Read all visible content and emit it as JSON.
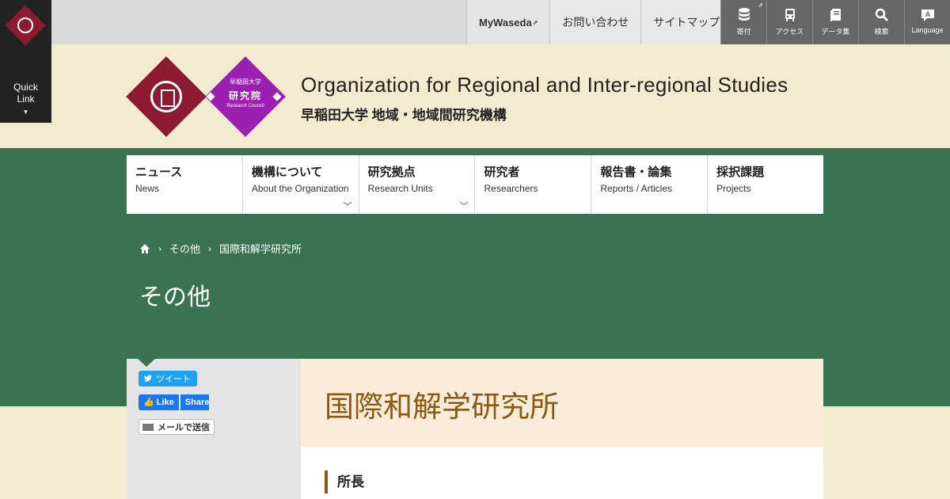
{
  "quicklink": {
    "label1": "Quick",
    "label2": "Link",
    "arrow": "▾"
  },
  "toplinks": [
    {
      "label": "MyWaseda",
      "ext": "⇗"
    },
    {
      "label": "お問い合わせ"
    },
    {
      "label": "サイトマップ"
    }
  ],
  "iconbar": [
    {
      "label": "寄付",
      "icon": "database-icon",
      "ext": "⇗"
    },
    {
      "label": "アクセス",
      "icon": "bus-icon"
    },
    {
      "label": "データ集",
      "icon": "book-icon"
    },
    {
      "label": "検索",
      "icon": "search-icon"
    },
    {
      "label": "Language",
      "icon": "language-icon"
    }
  ],
  "logo": {
    "line1": "早稲田大学",
    "line2": "研究院",
    "line3": "Research Council"
  },
  "site": {
    "title": "Organization for Regional and Inter-regional Studies",
    "subtitle": "早稲田大学 地域・地域間研究機構"
  },
  "nav": [
    {
      "jp": "ニュース",
      "en": "News",
      "dropdown": false
    },
    {
      "jp": "機構について",
      "en": "About the Organization",
      "dropdown": true
    },
    {
      "jp": "研究拠点",
      "en": "Research Units",
      "dropdown": true
    },
    {
      "jp": "研究者",
      "en": "Researchers",
      "dropdown": false
    },
    {
      "jp": "報告書・論集",
      "en": "Reports / Articles",
      "dropdown": false
    },
    {
      "jp": "採択課題",
      "en": "Projects",
      "dropdown": false
    }
  ],
  "breadcrumb": {
    "items": [
      "その他",
      "国際和解学研究所"
    ],
    "sep": "›"
  },
  "page": {
    "title": "その他"
  },
  "social": {
    "tweet": "ツイート",
    "like": "Like",
    "share": "Share",
    "mail": "メールで送信"
  },
  "content": {
    "heading": "国際和解学研究所",
    "section": "所長"
  },
  "colors": {
    "green": "#3a7350",
    "cream": "#f3ebcf",
    "waseda_red": "#8c1a30",
    "purple": "#9b1fb0",
    "gold": "#8a5a10"
  }
}
